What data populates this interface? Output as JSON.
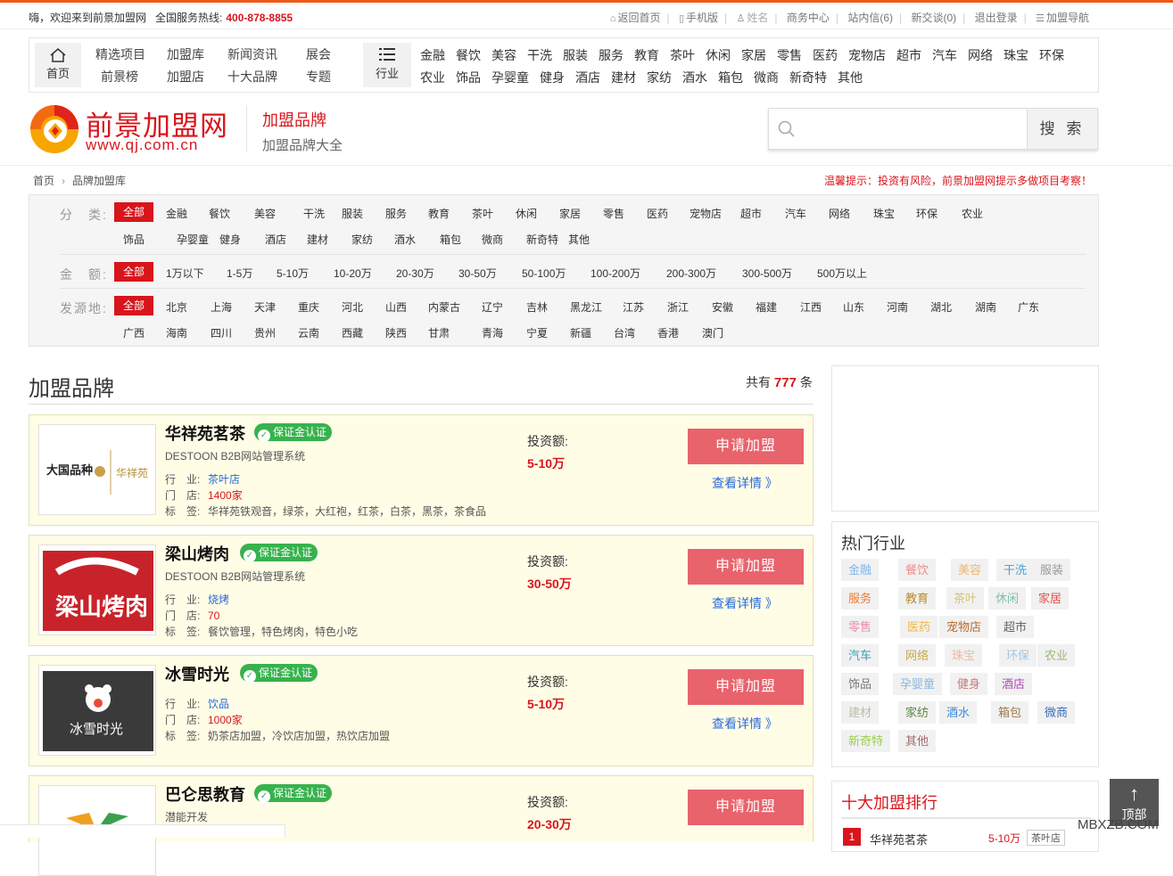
{
  "topbar": {
    "welcome": "嗨，欢迎来到前景加盟网",
    "hotline_label": "全国服务热线:",
    "hotline": "400-878-8855",
    "links": [
      "返回首页",
      "手机版",
      "姓名",
      "商务中心",
      "站内信(6)",
      "新交谈(0)",
      "退出登录",
      "加盟导航"
    ]
  },
  "nav": {
    "home": "首页",
    "col1": [
      "精选项目",
      "前景榜"
    ],
    "col2": [
      "加盟库",
      "加盟店"
    ],
    "col3": [
      "新闻资讯",
      "十大品牌"
    ],
    "col4": [
      "展会",
      "专题"
    ],
    "industry_label": "行业",
    "industry_row1": [
      "金融",
      "餐饮",
      "美容",
      "干洗",
      "服装",
      "服务",
      "教育",
      "茶叶",
      "休闲",
      "家居",
      "零售",
      "医药",
      "宠物店",
      "超市",
      "汽车",
      "网络",
      "珠宝",
      "环保"
    ],
    "industry_row2": [
      "农业",
      "饰品",
      "孕婴童",
      "健身",
      "酒店",
      "建材",
      "家纺",
      "酒水",
      "箱包",
      "微商",
      "新奇特",
      "其他"
    ]
  },
  "logo": {
    "name": "前景加盟网",
    "url": "www.qj.com.cn"
  },
  "channel": {
    "title": "加盟品牌",
    "subtitle": "加盟品牌大全"
  },
  "search": {
    "placeholder": "",
    "button": "搜 索"
  },
  "breadcrumb": [
    "首页",
    "品牌加盟库"
  ],
  "notice": "温馨提示：投资有风险，前景加盟网提示多做项目考察！",
  "filter": {
    "category_label": "分　类:",
    "categories": [
      "全部",
      "金融",
      "餐饮",
      "美容",
      "干洗",
      "服装",
      "服务",
      "教育",
      "茶叶",
      "休闲",
      "家居",
      "零售",
      "医药",
      "宠物店",
      "超市",
      "汽车",
      "网络",
      "珠宝",
      "环保",
      "农业",
      "饰品",
      "孕婴童",
      "健身",
      "酒店",
      "建材",
      "家纺",
      "酒水",
      "箱包",
      "微商",
      "新奇特",
      "其他"
    ],
    "amount_label": "金　额:",
    "amounts": [
      "全部",
      "1万以下",
      "1-5万",
      "5-10万",
      "10-20万",
      "20-30万",
      "30-50万",
      "50-100万",
      "100-200万",
      "200-300万",
      "300-500万",
      "500万以上"
    ],
    "origin_label": "发源地:",
    "origins": [
      "全部",
      "北京",
      "上海",
      "天津",
      "重庆",
      "河北",
      "山西",
      "内蒙古",
      "辽宁",
      "吉林",
      "黑龙江",
      "江苏",
      "浙江",
      "安徽",
      "福建",
      "江西",
      "山东",
      "河南",
      "湖北",
      "湖南",
      "广东",
      "广西",
      "海南",
      "四川",
      "贵州",
      "云南",
      "西藏",
      "陕西",
      "甘肃",
      "青海",
      "宁夏",
      "新疆",
      "台湾",
      "香港",
      "澳门"
    ]
  },
  "list": {
    "title": "加盟品牌",
    "count_prefix": "共有",
    "count": "777",
    "count_suffix": "条",
    "labels": {
      "industry": "行　业:",
      "stores": "门　店:",
      "tags": "标　签:",
      "invest": "投资额:",
      "apply": "申请加盟",
      "detail": "查看详情 》",
      "badge": "保证金认证"
    },
    "items": [
      {
        "name": "华祥苑茗茶",
        "sub": "DESTOON B2B网站管理系统",
        "industry": "茶叶店",
        "stores": "1400家",
        "tags": "华祥苑铁观音，绿茶，大红袍，红茶，白茶，黑茶，茶食品",
        "invest": "5-10万",
        "logo_text": "大国品种 华祥苑"
      },
      {
        "name": "梁山烤肉",
        "sub": "DESTOON B2B网站管理系统",
        "industry": "烧烤",
        "stores": "70",
        "tags": "餐饮管理，特色烤肉，特色小吃",
        "invest": "30-50万",
        "logo_text": "梁山烤肉"
      },
      {
        "name": "冰雪时光",
        "sub": "",
        "industry": "饮品",
        "stores": "1000家",
        "tags": "奶茶店加盟，冷饮店加盟，热饮店加盟",
        "invest": "5-10万",
        "logo_text": "冰雪时光"
      },
      {
        "name": "巴仑思教育",
        "sub": "潜能开发",
        "industry": "",
        "stores": "",
        "tags": "",
        "invest": "20-30万",
        "logo_text": ""
      }
    ]
  },
  "sidebar": {
    "hot_title": "热门行业",
    "hot_tags": [
      {
        "t": "金融",
        "c": "#7fb7e8"
      },
      {
        "t": "餐饮",
        "c": "#f08a8a"
      },
      {
        "t": "美容",
        "c": "#f2b468"
      },
      {
        "t": "干洗",
        "c": "#4aa3d8"
      },
      {
        "t": "服装",
        "c": "#999999"
      },
      {
        "t": "服务",
        "c": "#f07a2a"
      },
      {
        "t": "教育",
        "c": "#b88a2a"
      },
      {
        "t": "茶叶",
        "c": "#d7c27a"
      },
      {
        "t": "休闲",
        "c": "#7fc3a6"
      },
      {
        "t": "家居",
        "c": "#e05050"
      },
      {
        "t": "零售",
        "c": "#f08ab0"
      },
      {
        "t": "医药",
        "c": "#f0b84a"
      },
      {
        "t": "宠物店",
        "c": "#b86a2a"
      },
      {
        "t": "超市",
        "c": "#666666"
      },
      {
        "t": "汽车",
        "c": "#3a9ab8"
      },
      {
        "t": "网络",
        "c": "#c8a84a"
      },
      {
        "t": "珠宝",
        "c": "#f2b8a0"
      },
      {
        "t": "环保",
        "c": "#a0c8e8"
      },
      {
        "t": "农业",
        "c": "#9ab87a"
      },
      {
        "t": "饰品",
        "c": "#777777"
      },
      {
        "t": "孕婴童",
        "c": "#8ab8e0"
      },
      {
        "t": "健身",
        "c": "#c87a7a"
      },
      {
        "t": "酒店",
        "c": "#b04ab8"
      },
      {
        "t": "建材",
        "c": "#b8c0a8"
      },
      {
        "t": "家纺",
        "c": "#5a8a3a"
      },
      {
        "t": "酒水",
        "c": "#3a8ad8"
      },
      {
        "t": "箱包",
        "c": "#a07a4a"
      },
      {
        "t": "微商",
        "c": "#3a6ab8"
      },
      {
        "t": "新奇特",
        "c": "#9ad04a"
      },
      {
        "t": "其他",
        "c": "#a06a6a"
      }
    ],
    "top_title": "十大加盟排行",
    "top_rank": "1",
    "top_name": "华祥苑茗茶",
    "top_invest": "5-10万",
    "top_tag": "茶叶店"
  },
  "totop": {
    "arrow": "↑",
    "label": "顶部"
  },
  "watermark": "MBXZB.COM"
}
